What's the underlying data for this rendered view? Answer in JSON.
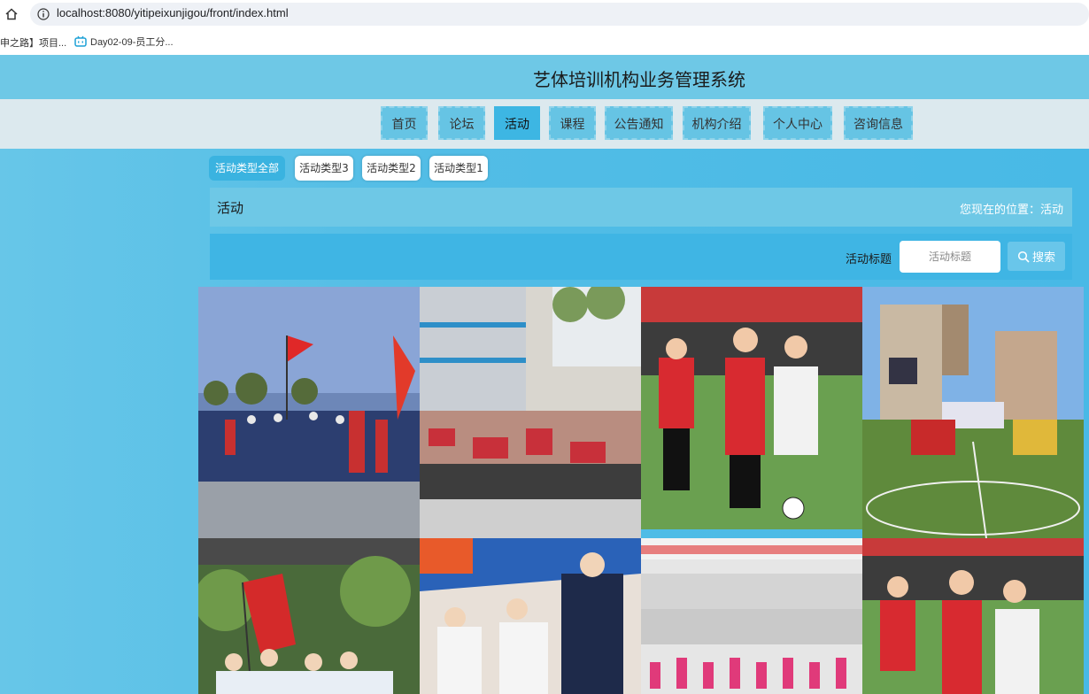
{
  "browser": {
    "url": "localhost:8080/yitipeixunjigou/front/index.html",
    "bookmarks": [
      {
        "label": "申之路】项目..."
      },
      {
        "label": "Day02-09-员工分..."
      }
    ]
  },
  "site": {
    "title": "艺体培训机构业务管理系统"
  },
  "nav": {
    "items": [
      {
        "label": "首页"
      },
      {
        "label": "论坛"
      },
      {
        "label": "活动"
      },
      {
        "label": "课程"
      },
      {
        "label": "公告通知"
      },
      {
        "label": "机构介绍"
      },
      {
        "label": "个人中心"
      },
      {
        "label": "咨询信息"
      }
    ],
    "active_index": 2
  },
  "type_tabs": [
    {
      "label": "活动类型全部"
    },
    {
      "label": "活动类型3"
    },
    {
      "label": "活动类型2"
    },
    {
      "label": "活动类型1"
    }
  ],
  "breadcrumb": {
    "title": "活动",
    "location": "您现在的位置：活动"
  },
  "search": {
    "label": "活动标题",
    "placeholder": "活动标题",
    "button_label": "搜索",
    "button_icon": "search-icon"
  },
  "activities": [
    {
      "scene": "flag-crowd-outdoor"
    },
    {
      "scene": "school-courtyard-crowd"
    },
    {
      "scene": "kids-football-match"
    },
    {
      "scene": "football-field-ceremony"
    },
    {
      "scene": "flag-group-trees"
    },
    {
      "scene": "students-medical-tent"
    },
    {
      "scene": "school-building-performance"
    },
    {
      "scene": "kids-football-match"
    }
  ],
  "colors": {
    "accent": "#3db6e3",
    "header": "#6ec8e6",
    "nav_bg": "#dce9ee"
  }
}
